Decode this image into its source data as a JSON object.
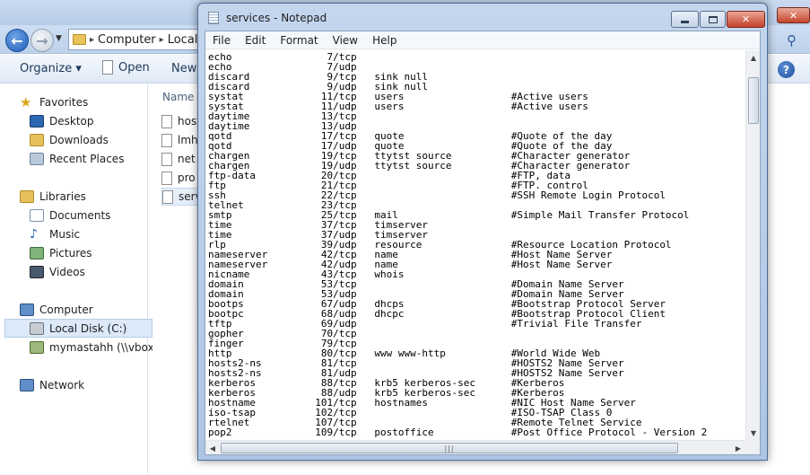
{
  "explorer": {
    "address": {
      "crumbs": [
        "Computer",
        "Local"
      ]
    },
    "toolbar": {
      "organize": "Organize ▾",
      "open": "Open",
      "new_folder": "New f"
    },
    "column_header": "Name",
    "nav": {
      "favorites": "Favorites",
      "desktop": "Desktop",
      "downloads": "Downloads",
      "recent_places": "Recent Places",
      "libraries": "Libraries",
      "documents": "Documents",
      "music": "Music",
      "pictures": "Pictures",
      "videos": "Videos",
      "computer": "Computer",
      "local_disk": "Local Disk (C:)",
      "network_share": "mymastahh (\\\\vbox",
      "network": "Network"
    },
    "files": [
      "host",
      "lmh",
      "net",
      "pro",
      "serv"
    ]
  },
  "notepad": {
    "title": "services - Notepad",
    "menu": {
      "file": "File",
      "edit": "Edit",
      "format": "Format",
      "view": "View",
      "help": "Help"
    },
    "lines": [
      [
        "echo",
        "7/tcp",
        "",
        ""
      ],
      [
        "echo",
        "7/udp",
        "",
        ""
      ],
      [
        "discard",
        "9/tcp",
        "sink null",
        ""
      ],
      [
        "discard",
        "9/udp",
        "sink null",
        ""
      ],
      [
        "systat",
        "11/tcp",
        "users",
        "#Active users"
      ],
      [
        "systat",
        "11/udp",
        "users",
        "#Active users"
      ],
      [
        "daytime",
        "13/tcp",
        "",
        ""
      ],
      [
        "daytime",
        "13/udp",
        "",
        ""
      ],
      [
        "qotd",
        "17/tcp",
        "quote",
        "#Quote of the day"
      ],
      [
        "qotd",
        "17/udp",
        "quote",
        "#Quote of the day"
      ],
      [
        "chargen",
        "19/tcp",
        "ttytst source",
        "#Character generator"
      ],
      [
        "chargen",
        "19/udp",
        "ttytst source",
        "#Character generator"
      ],
      [
        "ftp-data",
        "20/tcp",
        "",
        "#FTP, data"
      ],
      [
        "ftp",
        "21/tcp",
        "",
        "#FTP. control"
      ],
      [
        "ssh",
        "22/tcp",
        "",
        "#SSH Remote Login Protocol"
      ],
      [
        "telnet",
        "23/tcp",
        "",
        ""
      ],
      [
        "smtp",
        "25/tcp",
        "mail",
        "#Simple Mail Transfer Protocol"
      ],
      [
        "time",
        "37/tcp",
        "timserver",
        ""
      ],
      [
        "time",
        "37/udp",
        "timserver",
        ""
      ],
      [
        "rlp",
        "39/udp",
        "resource",
        "#Resource Location Protocol"
      ],
      [
        "nameserver",
        "42/tcp",
        "name",
        "#Host Name Server"
      ],
      [
        "nameserver",
        "42/udp",
        "name",
        "#Host Name Server"
      ],
      [
        "nicname",
        "43/tcp",
        "whois",
        ""
      ],
      [
        "domain",
        "53/tcp",
        "",
        "#Domain Name Server"
      ],
      [
        "domain",
        "53/udp",
        "",
        "#Domain Name Server"
      ],
      [
        "bootps",
        "67/udp",
        "dhcps",
        "#Bootstrap Protocol Server"
      ],
      [
        "bootpc",
        "68/udp",
        "dhcpc",
        "#Bootstrap Protocol Client"
      ],
      [
        "tftp",
        "69/udp",
        "",
        "#Trivial File Transfer"
      ],
      [
        "gopher",
        "70/tcp",
        "",
        ""
      ],
      [
        "finger",
        "79/tcp",
        "",
        ""
      ],
      [
        "http",
        "80/tcp",
        "www www-http",
        "#World Wide Web"
      ],
      [
        "hosts2-ns",
        "81/tcp",
        "",
        "#HOSTS2 Name Server"
      ],
      [
        "hosts2-ns",
        "81/udp",
        "",
        "#HOSTS2 Name Server"
      ],
      [
        "kerberos",
        "88/tcp",
        "krb5 kerberos-sec",
        "#Kerberos"
      ],
      [
        "kerberos",
        "88/udp",
        "krb5 kerberos-sec",
        "#Kerberos"
      ],
      [
        "hostname",
        "101/tcp",
        "hostnames",
        "#NIC Host Name Server"
      ],
      [
        "iso-tsap",
        "102/tcp",
        "",
        "#ISO-TSAP Class 0"
      ],
      [
        "rtelnet",
        "107/tcp",
        "",
        "#Remote Telnet Service"
      ],
      [
        "pop2",
        "109/tcp",
        "postoffice",
        "#Post Office Protocol - Version 2"
      ]
    ]
  }
}
